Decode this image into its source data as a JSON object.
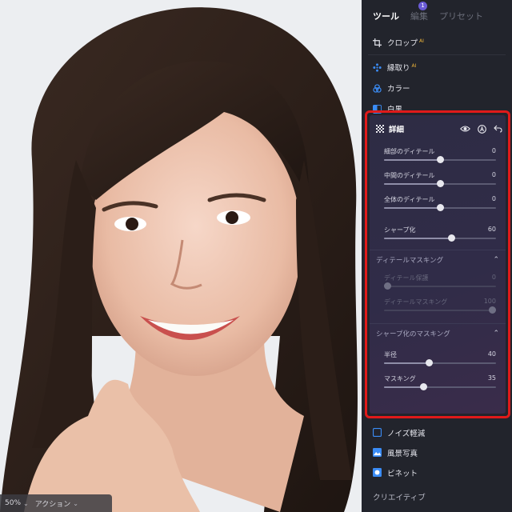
{
  "tabs": [
    {
      "label": "ツール",
      "active": true
    },
    {
      "label": "編集",
      "badge": "1"
    },
    {
      "label": "プリセット"
    }
  ],
  "tools_top": [
    {
      "label": "クロップ",
      "ai": "AI",
      "icon": "crop-icon"
    },
    {
      "label": "縁取り",
      "ai": "AI",
      "icon": "border-icon"
    },
    {
      "label": "カラー",
      "icon": "color-icon"
    },
    {
      "label": "白黒",
      "icon": "bw-icon"
    }
  ],
  "detail": {
    "title": "詳細",
    "sliders": [
      {
        "label": "細部のディテール",
        "value": "0",
        "level": 0.5
      },
      {
        "label": "中間のディテール",
        "value": "0",
        "level": 0.5
      },
      {
        "label": "全体のディテール",
        "value": "0",
        "level": 0.5
      },
      {
        "label": "シャープ化",
        "value": "60",
        "level": 0.6
      }
    ],
    "detail_masking": {
      "title": "ディテールマスキング",
      "sliders": [
        {
          "label": "ディテール保護",
          "value": "0",
          "level": 0.0,
          "disabled": true
        },
        {
          "label": "ディテールマスキング",
          "value": "100",
          "level": 1.0,
          "disabled": true
        }
      ]
    },
    "sharpen_masking": {
      "title": "シャープ化のマスキング",
      "sliders": [
        {
          "label": "半径",
          "value": "40",
          "level": 0.4
        },
        {
          "label": "マスキング",
          "value": "35",
          "level": 0.35
        }
      ]
    }
  },
  "tools_bottom": [
    {
      "label": "ノイズ軽減",
      "icon": "noise-icon"
    },
    {
      "label": "風景写真",
      "icon": "landscape-icon"
    },
    {
      "label": "ビネット",
      "icon": "vignette-icon"
    }
  ],
  "creative_label": "クリエイティブ",
  "bottom_bar": {
    "zoom": "50%",
    "action": "アクション"
  },
  "colors": {
    "highlight": "#e01a1a",
    "accent": "#6a5bd6",
    "ai": "#f0b63a"
  }
}
